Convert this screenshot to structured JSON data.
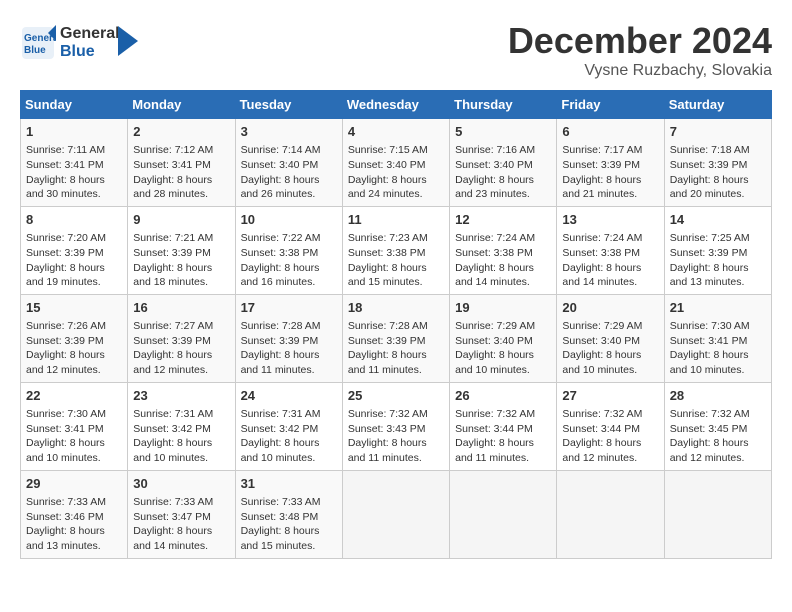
{
  "header": {
    "logo_line1": "General",
    "logo_line2": "Blue",
    "month": "December 2024",
    "location": "Vysne Ruzbachy, Slovakia"
  },
  "days_of_week": [
    "Sunday",
    "Monday",
    "Tuesday",
    "Wednesday",
    "Thursday",
    "Friday",
    "Saturday"
  ],
  "weeks": [
    [
      {
        "day": "1",
        "info": "Sunrise: 7:11 AM\nSunset: 3:41 PM\nDaylight: 8 hours\nand 30 minutes."
      },
      {
        "day": "2",
        "info": "Sunrise: 7:12 AM\nSunset: 3:41 PM\nDaylight: 8 hours\nand 28 minutes."
      },
      {
        "day": "3",
        "info": "Sunrise: 7:14 AM\nSunset: 3:40 PM\nDaylight: 8 hours\nand 26 minutes."
      },
      {
        "day": "4",
        "info": "Sunrise: 7:15 AM\nSunset: 3:40 PM\nDaylight: 8 hours\nand 24 minutes."
      },
      {
        "day": "5",
        "info": "Sunrise: 7:16 AM\nSunset: 3:40 PM\nDaylight: 8 hours\nand 23 minutes."
      },
      {
        "day": "6",
        "info": "Sunrise: 7:17 AM\nSunset: 3:39 PM\nDaylight: 8 hours\nand 21 minutes."
      },
      {
        "day": "7",
        "info": "Sunrise: 7:18 AM\nSunset: 3:39 PM\nDaylight: 8 hours\nand 20 minutes."
      }
    ],
    [
      {
        "day": "8",
        "info": "Sunrise: 7:20 AM\nSunset: 3:39 PM\nDaylight: 8 hours\nand 19 minutes."
      },
      {
        "day": "9",
        "info": "Sunrise: 7:21 AM\nSunset: 3:39 PM\nDaylight: 8 hours\nand 18 minutes."
      },
      {
        "day": "10",
        "info": "Sunrise: 7:22 AM\nSunset: 3:38 PM\nDaylight: 8 hours\nand 16 minutes."
      },
      {
        "day": "11",
        "info": "Sunrise: 7:23 AM\nSunset: 3:38 PM\nDaylight: 8 hours\nand 15 minutes."
      },
      {
        "day": "12",
        "info": "Sunrise: 7:24 AM\nSunset: 3:38 PM\nDaylight: 8 hours\nand 14 minutes."
      },
      {
        "day": "13",
        "info": "Sunrise: 7:24 AM\nSunset: 3:38 PM\nDaylight: 8 hours\nand 14 minutes."
      },
      {
        "day": "14",
        "info": "Sunrise: 7:25 AM\nSunset: 3:39 PM\nDaylight: 8 hours\nand 13 minutes."
      }
    ],
    [
      {
        "day": "15",
        "info": "Sunrise: 7:26 AM\nSunset: 3:39 PM\nDaylight: 8 hours\nand 12 minutes."
      },
      {
        "day": "16",
        "info": "Sunrise: 7:27 AM\nSunset: 3:39 PM\nDaylight: 8 hours\nand 12 minutes."
      },
      {
        "day": "17",
        "info": "Sunrise: 7:28 AM\nSunset: 3:39 PM\nDaylight: 8 hours\nand 11 minutes."
      },
      {
        "day": "18",
        "info": "Sunrise: 7:28 AM\nSunset: 3:39 PM\nDaylight: 8 hours\nand 11 minutes."
      },
      {
        "day": "19",
        "info": "Sunrise: 7:29 AM\nSunset: 3:40 PM\nDaylight: 8 hours\nand 10 minutes."
      },
      {
        "day": "20",
        "info": "Sunrise: 7:29 AM\nSunset: 3:40 PM\nDaylight: 8 hours\nand 10 minutes."
      },
      {
        "day": "21",
        "info": "Sunrise: 7:30 AM\nSunset: 3:41 PM\nDaylight: 8 hours\nand 10 minutes."
      }
    ],
    [
      {
        "day": "22",
        "info": "Sunrise: 7:30 AM\nSunset: 3:41 PM\nDaylight: 8 hours\nand 10 minutes."
      },
      {
        "day": "23",
        "info": "Sunrise: 7:31 AM\nSunset: 3:42 PM\nDaylight: 8 hours\nand 10 minutes."
      },
      {
        "day": "24",
        "info": "Sunrise: 7:31 AM\nSunset: 3:42 PM\nDaylight: 8 hours\nand 10 minutes."
      },
      {
        "day": "25",
        "info": "Sunrise: 7:32 AM\nSunset: 3:43 PM\nDaylight: 8 hours\nand 11 minutes."
      },
      {
        "day": "26",
        "info": "Sunrise: 7:32 AM\nSunset: 3:44 PM\nDaylight: 8 hours\nand 11 minutes."
      },
      {
        "day": "27",
        "info": "Sunrise: 7:32 AM\nSunset: 3:44 PM\nDaylight: 8 hours\nand 12 minutes."
      },
      {
        "day": "28",
        "info": "Sunrise: 7:32 AM\nSunset: 3:45 PM\nDaylight: 8 hours\nand 12 minutes."
      }
    ],
    [
      {
        "day": "29",
        "info": "Sunrise: 7:33 AM\nSunset: 3:46 PM\nDaylight: 8 hours\nand 13 minutes."
      },
      {
        "day": "30",
        "info": "Sunrise: 7:33 AM\nSunset: 3:47 PM\nDaylight: 8 hours\nand 14 minutes."
      },
      {
        "day": "31",
        "info": "Sunrise: 7:33 AM\nSunset: 3:48 PM\nDaylight: 8 hours\nand 15 minutes."
      },
      {
        "day": "",
        "info": ""
      },
      {
        "day": "",
        "info": ""
      },
      {
        "day": "",
        "info": ""
      },
      {
        "day": "",
        "info": ""
      }
    ]
  ]
}
